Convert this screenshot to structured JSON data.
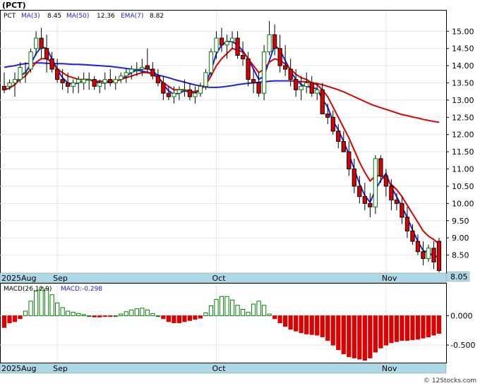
{
  "title": "(PCT)",
  "legend": {
    "ticker": "PCT",
    "ma3_label": "MA(3)",
    "ma3_value": "8.45",
    "ma50_label": "MA(50)",
    "ma50_value": "12.36",
    "ema7_label": "EMA(7)",
    "ema7_value": "8.82"
  },
  "macd_legend": {
    "label": "MACD(26,12,9)",
    "value_label": "MACD:-0.298"
  },
  "last_price_label": "8.05",
  "watermark": "© 12Stocks.com",
  "month_labels": [
    {
      "text": "2025Aug",
      "index": 0
    },
    {
      "text": "Sep",
      "index": 10
    },
    {
      "text": "Oct",
      "index": 40
    },
    {
      "text": "Nov",
      "index": 72
    }
  ],
  "colors": {
    "up": "#008000",
    "down": "#dd0000",
    "ma": "#2020dd",
    "ema": "#dd0000",
    "band": "#add8e6",
    "macd_pos": "#008000",
    "macd_neg": "#dd0000"
  },
  "chart_data": [
    {
      "type": "candlestick",
      "ylim": [
        8.0,
        15.6
      ],
      "yticks": [
        "15.00",
        "14.50",
        "14.00",
        "13.50",
        "13.00",
        "12.50",
        "12.00",
        "11.50",
        "11.00",
        "10.50",
        "10.00",
        "9.50",
        "9.00",
        "8.50"
      ],
      "ohlc": [
        [
          13.4,
          13.8,
          13.2,
          13.3
        ],
        [
          13.4,
          13.6,
          13.3,
          13.5
        ],
        [
          13.5,
          13.8,
          13.1,
          13.6
        ],
        [
          13.6,
          14.1,
          13.5,
          13.95
        ],
        [
          13.8,
          14.1,
          13.5,
          13.8
        ],
        [
          13.9,
          14.5,
          13.8,
          14.4
        ],
        [
          14.5,
          15.0,
          14.3,
          14.8
        ],
        [
          14.8,
          15.1,
          14.2,
          14.5
        ],
        [
          14.5,
          14.9,
          13.8,
          14.2
        ],
        [
          14.2,
          14.4,
          13.8,
          13.9
        ],
        [
          13.9,
          14.2,
          13.5,
          13.6
        ],
        [
          13.6,
          13.9,
          13.3,
          13.5
        ],
        [
          13.5,
          13.8,
          13.2,
          13.4
        ],
        [
          13.4,
          13.6,
          13.2,
          13.5
        ],
        [
          13.5,
          13.7,
          13.2,
          13.6
        ],
        [
          13.5,
          13.8,
          13.3,
          13.6
        ],
        [
          13.6,
          13.8,
          13.3,
          13.6
        ],
        [
          13.6,
          13.7,
          13.3,
          13.4
        ],
        [
          13.4,
          13.6,
          13.2,
          13.5
        ],
        [
          13.5,
          13.8,
          13.3,
          13.6
        ],
        [
          13.6,
          13.9,
          13.4,
          13.5
        ],
        [
          13.5,
          13.7,
          13.3,
          13.6
        ],
        [
          13.6,
          13.8,
          13.5,
          13.7
        ],
        [
          13.7,
          13.9,
          13.5,
          13.8
        ],
        [
          13.8,
          14.0,
          13.6,
          13.9
        ],
        [
          13.9,
          14.1,
          13.7,
          13.9
        ],
        [
          13.9,
          14.2,
          13.7,
          13.95
        ],
        [
          14.0,
          14.5,
          13.8,
          13.9
        ],
        [
          13.9,
          14.1,
          13.6,
          13.7
        ],
        [
          13.7,
          13.9,
          13.4,
          13.5
        ],
        [
          13.5,
          13.7,
          13.0,
          13.2
        ],
        [
          13.2,
          13.4,
          13.0,
          13.1
        ],
        [
          13.1,
          13.4,
          12.9,
          13.2
        ],
        [
          13.2,
          13.4,
          13.0,
          13.3
        ],
        [
          13.3,
          13.6,
          13.1,
          13.3
        ],
        [
          13.3,
          13.5,
          13.0,
          13.1
        ],
        [
          13.1,
          13.4,
          12.9,
          13.2
        ],
        [
          13.2,
          13.5,
          13.1,
          13.4
        ],
        [
          13.4,
          13.9,
          13.3,
          13.8
        ],
        [
          13.8,
          14.5,
          13.7,
          14.4
        ],
        [
          14.4,
          15.0,
          14.2,
          14.8
        ],
        [
          14.8,
          15.1,
          14.4,
          14.6
        ],
        [
          14.6,
          14.9,
          14.2,
          14.7
        ],
        [
          14.7,
          15.0,
          14.5,
          14.8
        ],
        [
          14.8,
          15.0,
          14.2,
          14.3
        ],
        [
          14.3,
          14.7,
          14.0,
          14.2
        ],
        [
          14.2,
          14.4,
          13.4,
          13.6
        ],
        [
          13.6,
          13.9,
          13.2,
          13.5
        ],
        [
          13.5,
          13.8,
          13.1,
          13.2
        ],
        [
          13.2,
          14.6,
          13.0,
          14.4
        ],
        [
          14.4,
          15.3,
          14.3,
          14.9
        ],
        [
          14.9,
          15.2,
          14.3,
          14.5
        ],
        [
          14.5,
          14.9,
          13.8,
          14.0
        ],
        [
          14.0,
          14.6,
          13.7,
          13.9
        ],
        [
          13.9,
          14.2,
          13.4,
          13.6
        ],
        [
          13.6,
          13.9,
          13.1,
          13.3
        ],
        [
          13.3,
          13.7,
          13.0,
          13.4
        ],
        [
          13.4,
          13.8,
          13.2,
          13.5
        ],
        [
          13.5,
          13.7,
          13.1,
          13.2
        ],
        [
          13.2,
          13.5,
          13.0,
          13.3
        ],
        [
          13.3,
          13.5,
          12.7,
          12.6
        ],
        [
          12.6,
          12.9,
          12.3,
          12.5
        ],
        [
          12.5,
          12.7,
          12.0,
          12.1
        ],
        [
          12.1,
          12.3,
          11.6,
          11.8
        ],
        [
          11.8,
          12.1,
          11.6,
          11.5
        ],
        [
          11.5,
          11.8,
          10.8,
          11.0
        ],
        [
          11.0,
          11.3,
          10.3,
          10.5
        ],
        [
          10.5,
          10.8,
          10.0,
          10.2
        ],
        [
          10.2,
          10.6,
          9.8,
          10.0
        ],
        [
          10.0,
          10.3,
          9.6,
          9.9
        ],
        [
          9.9,
          11.4,
          9.7,
          11.3
        ],
        [
          11.3,
          11.4,
          10.6,
          10.8
        ],
        [
          10.8,
          11.0,
          10.2,
          10.5
        ],
        [
          10.5,
          10.7,
          9.8,
          10.1
        ],
        [
          10.1,
          10.3,
          9.8,
          10.0
        ],
        [
          10.0,
          10.2,
          9.4,
          9.6
        ],
        [
          9.6,
          9.9,
          9.0,
          9.2
        ],
        [
          9.2,
          9.4,
          8.8,
          8.9
        ],
        [
          8.9,
          9.1,
          8.5,
          8.6
        ],
        [
          8.6,
          8.9,
          8.2,
          8.4
        ],
        [
          8.4,
          8.8,
          8.3,
          8.7
        ],
        [
          8.7,
          8.9,
          8.1,
          8.3
        ],
        [
          8.9,
          9.0,
          8.0,
          8.05
        ]
      ],
      "ema7": [
        13.3,
        13.35,
        13.45,
        13.6,
        13.7,
        13.9,
        14.1,
        14.2,
        14.2,
        14.1,
        13.9,
        13.8,
        13.7,
        13.65,
        13.6,
        13.6,
        13.6,
        13.55,
        13.55,
        13.55,
        13.55,
        13.55,
        13.6,
        13.65,
        13.7,
        13.75,
        13.8,
        13.8,
        13.75,
        13.65,
        13.5,
        13.4,
        13.3,
        13.3,
        13.3,
        13.25,
        13.25,
        13.3,
        13.45,
        13.7,
        14.0,
        14.2,
        14.35,
        14.5,
        14.45,
        14.4,
        14.2,
        14.0,
        13.8,
        13.9,
        14.1,
        14.2,
        14.15,
        14.05,
        13.9,
        13.75,
        13.65,
        13.6,
        13.5,
        13.45,
        13.3,
        13.1,
        12.8,
        12.5,
        12.2,
        11.9,
        11.55,
        11.2,
        10.9,
        10.65,
        10.8,
        10.8,
        10.7,
        10.55,
        10.4,
        10.2,
        9.95,
        9.7,
        9.45,
        9.2,
        9.05,
        8.95,
        8.82
      ],
      "ma3": [
        13.3,
        13.35,
        13.45,
        13.7,
        13.8,
        14.05,
        14.35,
        14.55,
        14.5,
        14.2,
        13.9,
        13.65,
        13.5,
        13.47,
        13.5,
        13.57,
        13.6,
        13.53,
        13.5,
        13.5,
        13.53,
        13.55,
        13.6,
        13.7,
        13.8,
        13.87,
        13.9,
        13.92,
        13.85,
        13.7,
        13.45,
        13.27,
        13.17,
        13.2,
        13.27,
        13.23,
        13.2,
        13.3,
        13.5,
        13.85,
        14.35,
        14.6,
        14.7,
        14.7,
        14.6,
        14.43,
        14.2,
        13.9,
        13.6,
        13.7,
        14.15,
        14.6,
        14.45,
        14.15,
        13.85,
        13.6,
        13.45,
        13.4,
        13.37,
        13.33,
        13.03,
        12.8,
        12.4,
        12.13,
        11.8,
        11.43,
        11.0,
        10.57,
        10.23,
        10.03,
        10.4,
        10.67,
        10.87,
        10.47,
        10.2,
        9.9,
        9.6,
        9.23,
        8.9,
        8.63,
        8.57,
        8.47,
        8.45
      ],
      "ma50": [
        13.95,
        13.98,
        14.0,
        14.04,
        14.06,
        14.07,
        14.08,
        14.08,
        14.07,
        14.07,
        14.06,
        14.06,
        14.05,
        14.04,
        14.04,
        14.03,
        14.02,
        14.01,
        14.0,
        13.99,
        13.98,
        13.96,
        13.94,
        13.92,
        13.9,
        13.87,
        13.84,
        13.81,
        13.77,
        13.73,
        13.69,
        13.65,
        13.6,
        13.56,
        13.52,
        13.48,
        13.44,
        13.41,
        13.38,
        13.37,
        13.37,
        13.38,
        13.4,
        13.42,
        13.45,
        13.47,
        13.49,
        13.5,
        13.52,
        13.53,
        13.55,
        13.56,
        13.56,
        13.56,
        13.56,
        13.55,
        13.54,
        13.53,
        13.51,
        13.48,
        13.45,
        13.4,
        13.35,
        13.3,
        13.24,
        13.17,
        13.1,
        13.03,
        12.96,
        12.89,
        12.83,
        12.78,
        12.73,
        12.68,
        12.63,
        12.58,
        12.55,
        12.51,
        12.48,
        12.44,
        12.41,
        12.38,
        12.36
      ],
      "ma_start_index": 0,
      "ma50_end_index": 54
    },
    {
      "type": "bar",
      "ylim": [
        -0.8,
        0.55
      ],
      "yticks": [
        "0.000",
        "-0.500"
      ],
      "macd_hist": [
        -0.2,
        -0.12,
        -0.1,
        -0.05,
        0.08,
        0.25,
        0.42,
        0.48,
        0.46,
        0.36,
        0.22,
        0.14,
        0.08,
        0.06,
        0.04,
        0.02,
        0.0,
        -0.02,
        -0.02,
        -0.01,
        -0.01,
        0.0,
        0.03,
        0.07,
        0.1,
        0.12,
        0.13,
        0.1,
        0.04,
        0.0,
        -0.05,
        -0.1,
        -0.12,
        -0.12,
        -0.1,
        -0.08,
        -0.06,
        -0.04,
        0.05,
        0.17,
        0.28,
        0.33,
        0.33,
        0.27,
        0.18,
        0.11,
        0.06,
        0.2,
        0.25,
        0.18,
        0.03,
        -0.05,
        -0.12,
        -0.18,
        -0.23,
        -0.26,
        -0.29,
        -0.31,
        -0.32,
        -0.33,
        -0.36,
        -0.42,
        -0.5,
        -0.58,
        -0.65,
        -0.7,
        -0.72,
        -0.74,
        -0.76,
        -0.72,
        -0.62,
        -0.55,
        -0.5,
        -0.46,
        -0.44,
        -0.42,
        -0.42,
        -0.41,
        -0.4,
        -0.38,
        -0.36,
        -0.33,
        -0.3
      ]
    }
  ]
}
